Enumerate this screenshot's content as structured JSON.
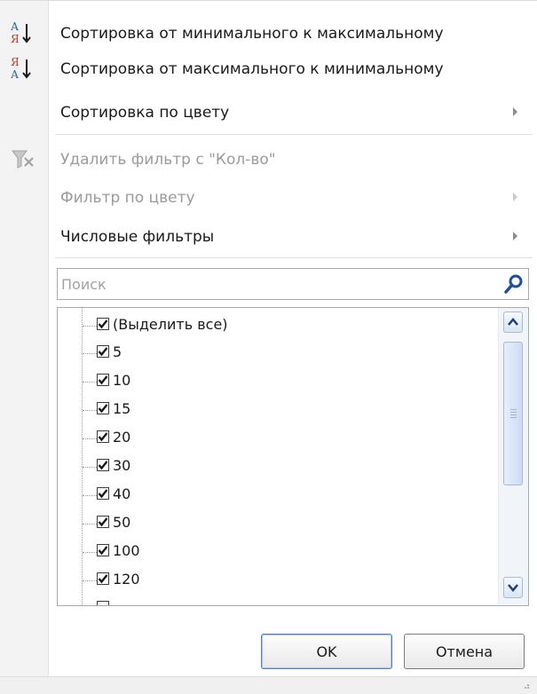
{
  "menu": {
    "sort_asc": "Сортировка от минимального к максимальному",
    "sort_desc": "Сортировка от максимального к минимальному",
    "sort_by_color": "Сортировка по цвету",
    "clear_filter": "Удалить фильтр с \"Кол-во\"",
    "filter_by_color": "Фильтр по цвету",
    "number_filters": "Числовые фильтры"
  },
  "search": {
    "placeholder": "Поиск",
    "value": ""
  },
  "list": {
    "items": [
      {
        "label": "(Выделить все)",
        "checked": true
      },
      {
        "label": "5",
        "checked": true
      },
      {
        "label": "10",
        "checked": true
      },
      {
        "label": "15",
        "checked": true
      },
      {
        "label": "20",
        "checked": true
      },
      {
        "label": "30",
        "checked": true
      },
      {
        "label": "40",
        "checked": true
      },
      {
        "label": "50",
        "checked": true
      },
      {
        "label": "100",
        "checked": true
      },
      {
        "label": "120",
        "checked": true
      }
    ]
  },
  "buttons": {
    "ok": "OK",
    "cancel": "Отмена"
  },
  "colors": {
    "accent": "#2a5fb0",
    "disabled_text": "#9b9b9b",
    "scroll": "#cddcf3"
  },
  "icons": [
    "sort-asc-icon",
    "sort-desc-icon",
    "clear-filter-icon",
    "search-icon",
    "scroll-up-icon",
    "scroll-down-icon",
    "checkmark-icon",
    "submenu-arrow-icon"
  ]
}
